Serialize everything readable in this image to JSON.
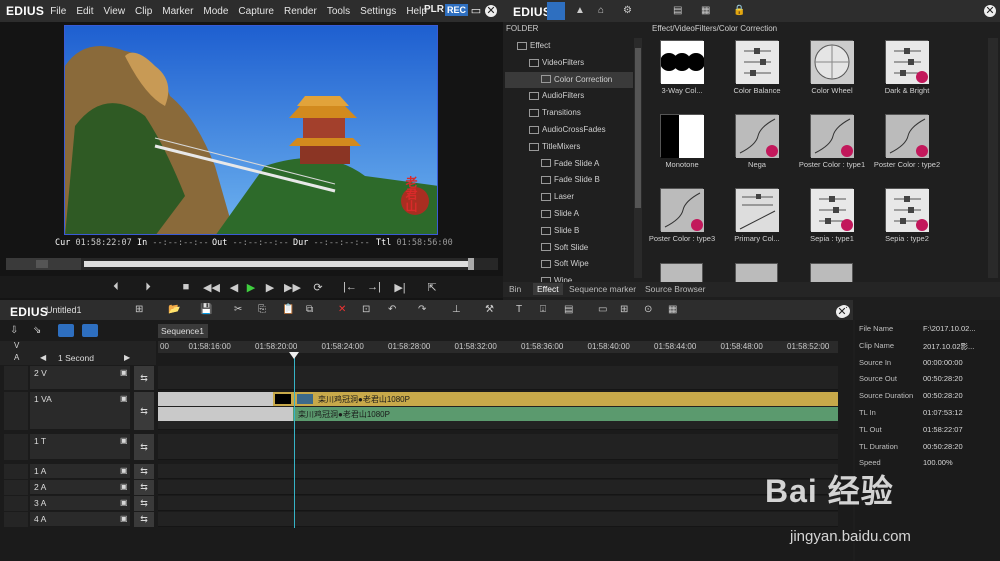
{
  "player": {
    "app": "EDIUS",
    "menu": [
      "File",
      "Edit",
      "View",
      "Clip",
      "Marker",
      "Mode",
      "Capture",
      "Render",
      "Tools",
      "Settings",
      "Help"
    ],
    "plr": "PLR",
    "rec": "REC",
    "timecodes": [
      {
        "label": "Cur",
        "value": "01:58:22:07"
      },
      {
        "label": "In",
        "value": "--:--:--:--"
      },
      {
        "label": "Out",
        "value": "--:--:--:--"
      },
      {
        "label": "Dur",
        "value": "--:--:--:--"
      },
      {
        "label": "Ttl",
        "value": "01:58:56:00"
      }
    ],
    "image_caption": "老君山"
  },
  "browser": {
    "app": "EDIUS",
    "folder_label": "FOLDER",
    "path": "Effect/VideoFilters/Color Correction",
    "tree": [
      {
        "label": "Effect",
        "indent": 1
      },
      {
        "label": "VideoFilters",
        "indent": 2
      },
      {
        "label": "Color Correction",
        "indent": 3,
        "selected": true
      },
      {
        "label": "AudioFilters",
        "indent": 2
      },
      {
        "label": "Transitions",
        "indent": 2
      },
      {
        "label": "AudioCrossFades",
        "indent": 2
      },
      {
        "label": "TitleMixers",
        "indent": 2
      },
      {
        "label": "Fade Slide A",
        "indent": 3
      },
      {
        "label": "Fade Slide B",
        "indent": 3
      },
      {
        "label": "Laser",
        "indent": 3
      },
      {
        "label": "Slide A",
        "indent": 3
      },
      {
        "label": "Slide B",
        "indent": 3
      },
      {
        "label": "Soft Slide",
        "indent": 3
      },
      {
        "label": "Soft Wipe",
        "indent": 3
      },
      {
        "label": "Wipe",
        "indent": 3
      }
    ],
    "effects": [
      {
        "label": "3-Way Col...",
        "icon": "three-circles"
      },
      {
        "label": "Color Balance",
        "icon": "sliders"
      },
      {
        "label": "Color Wheel",
        "icon": "wheel"
      },
      {
        "label": "Dark & Bright",
        "icon": "sliders-s"
      },
      {
        "label": "Monotone",
        "icon": "monotone"
      },
      {
        "label": "Nega",
        "icon": "curve-s"
      },
      {
        "label": "Poster Color : type1",
        "icon": "curve-s"
      },
      {
        "label": "Poster Color : type2",
        "icon": "curve-s"
      },
      {
        "label": "Poster Color : type3",
        "icon": "curve-s"
      },
      {
        "label": "Primary Col...",
        "icon": "sliders-curve"
      },
      {
        "label": "Sepia : type1",
        "icon": "sliders-s"
      },
      {
        "label": "Sepia : type2",
        "icon": "sliders-s"
      }
    ],
    "tabs": [
      "Bin",
      "Effect",
      "Sequence marker",
      "Source Browser"
    ],
    "active_tab": "Effect"
  },
  "timeline": {
    "app": "EDIUS",
    "project": "Untitled1",
    "sequence": "Sequence1",
    "scale": "1 Second",
    "ruler": [
      "00",
      "01:58:16:00",
      "01:58:20:00",
      "01:58:24:00",
      "01:58:28:00",
      "01:58:32:00",
      "01:58:36:00",
      "01:58:40:00",
      "01:58:44:00",
      "01:58:48:00",
      "01:58:52:00"
    ],
    "tracks": [
      "2 V",
      "1 VA",
      "1 T",
      "1 A",
      "2 A",
      "3 A",
      "4 A"
    ],
    "clip_video": "栾川鸡冠洞●老君山1080P",
    "clip_audio": "栾川鸡冠洞●老君山1080P"
  },
  "info": {
    "rows": [
      {
        "k": "File Name",
        "v": "F:\\2017.10.02..."
      },
      {
        "k": "Clip Name",
        "v": "2017.10.02影..."
      },
      {
        "k": "Source In",
        "v": "00:00:00:00"
      },
      {
        "k": "Source Out",
        "v": "00:50:28:20"
      },
      {
        "k": "Source Duration",
        "v": "00:50:28:20"
      },
      {
        "k": "TL In",
        "v": "01:07:53:12"
      },
      {
        "k": "TL Out",
        "v": "01:58:22:07"
      },
      {
        "k": "TL Duration",
        "v": "00:50:28:20"
      },
      {
        "k": "Speed",
        "v": "100.00%"
      }
    ]
  },
  "watermark": {
    "main": "Bai 经验",
    "sub": "jingyan.baidu.com"
  },
  "colors": {
    "accent": "#2e6fc0",
    "clip_gold": "#c8a94a",
    "clip_green": "#5b9a6e",
    "playhead": "#36b3c6"
  }
}
